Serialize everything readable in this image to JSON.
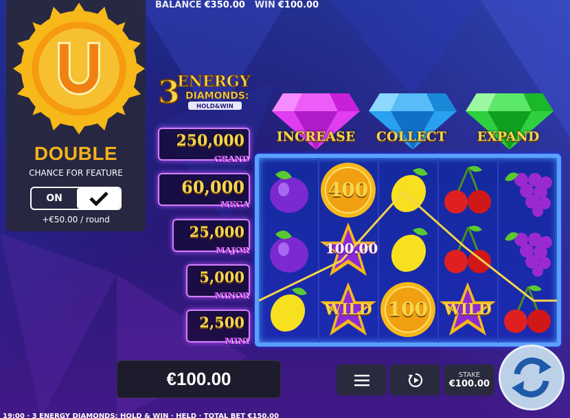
{
  "topbar": {
    "balance_label": "BALANCE",
    "balance_value": "€350.00",
    "win_label": "WIN",
    "win_value": "€100.00"
  },
  "feature": {
    "title": "DOUBLE",
    "subtitle": "CHANCE FOR FEATURE",
    "toggle_on_label": "ON",
    "cost": "+€50.00 / round",
    "badge_icon": "horseshoe-icon"
  },
  "logo": {
    "line1": "3",
    "line2": "ENERGY",
    "line3": "DIAMONDS:",
    "line4": "HOLD&WIN"
  },
  "jackpots": [
    {
      "amount": "250,000",
      "tier": "GRAND"
    },
    {
      "amount": "60,000",
      "tier": "MEGA"
    },
    {
      "amount": "25,000",
      "tier": "MAJOR"
    },
    {
      "amount": "5,000",
      "tier": "MINOR"
    },
    {
      "amount": "2,500",
      "tier": "MINI"
    }
  ],
  "gems": [
    {
      "label": "INCREASE",
      "color": "#e03cf0"
    },
    {
      "label": "COLLECT",
      "color": "#2aa0f0"
    },
    {
      "label": "EXPAND",
      "color": "#2ed040"
    }
  ],
  "reels": {
    "grid": [
      [
        "plum",
        "coin",
        "lemon",
        "cherry",
        "grapes"
      ],
      [
        "plum",
        "wild",
        "lemon",
        "cherry",
        "grapes"
      ],
      [
        "lemon",
        "wild",
        "coin",
        "wild",
        "cherry"
      ]
    ],
    "coin_values": {
      "0-1": "400",
      "2-2": "100"
    },
    "wild_label": "WILD",
    "win_amount": "100.00"
  },
  "bottom": {
    "win_display": "€100.00",
    "menu_icon": "menu-icon",
    "autoplay_icon": "autoplay-icon",
    "stake_label": "STAKE",
    "stake_value": "€100.00",
    "spin_icon": "spin-icon"
  },
  "footer": {
    "text": "19:00 · 3 ENERGY DIAMONDS: HOLD & WIN · HELD · TOTAL BET €150.00"
  },
  "colors": {
    "gold": "#f7d54a",
    "purple": "#c03cf0",
    "frame": "#5aa0ff"
  }
}
